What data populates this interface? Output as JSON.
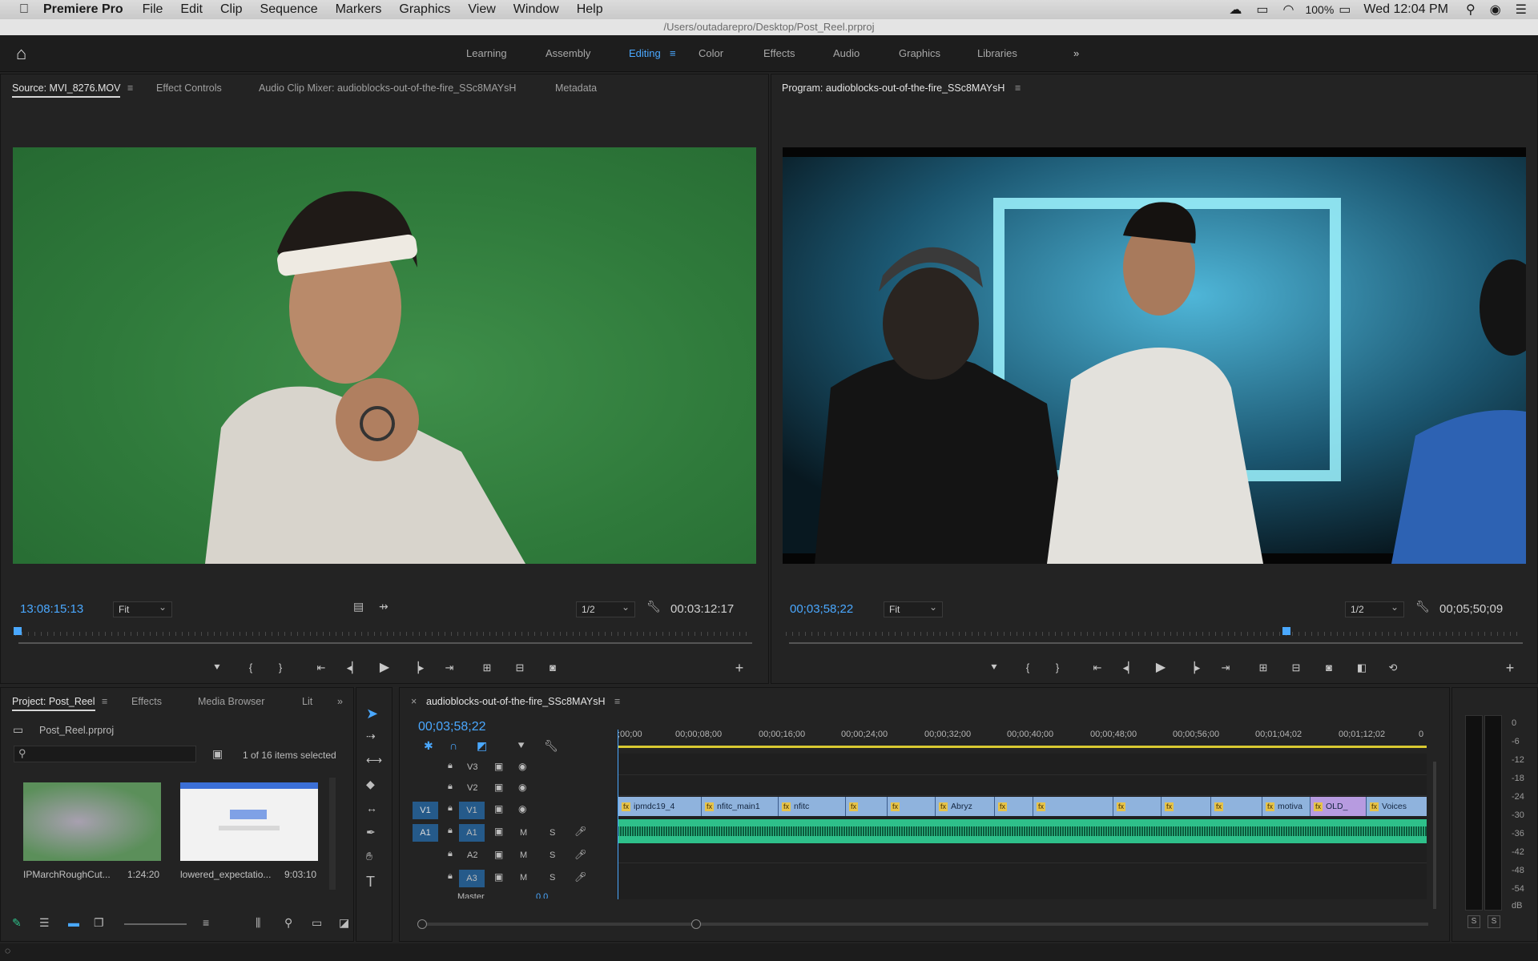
{
  "menubar": {
    "app": "Premiere Pro",
    "items": [
      "File",
      "Edit",
      "Clip",
      "Sequence",
      "Markers",
      "Graphics",
      "View",
      "Window",
      "Help"
    ],
    "battery": "100%",
    "clock": "Wed 12:04 PM"
  },
  "titlebar": "/Users/outadarepro/Desktop/Post_Reel.prproj",
  "workspaces": [
    "Learning",
    "Assembly",
    "Editing",
    "Color",
    "Effects",
    "Audio",
    "Graphics",
    "Libraries"
  ],
  "active_workspace": "Editing",
  "source": {
    "tabs": [
      "Source: MVI_8276.MOV",
      "Effect Controls",
      "Audio Clip Mixer: audioblocks-out-of-the-fire_SSc8MAYsH",
      "Metadata"
    ],
    "timecode": "13:08:15:13",
    "fit": "Fit",
    "resolution": "1/2",
    "duration": "00:03:12:17"
  },
  "program": {
    "tab": "Program: audioblocks-out-of-the-fire_SSc8MAYsH",
    "timecode": "00;03;58;22",
    "fit": "Fit",
    "resolution": "1/2",
    "duration": "00;05;50;09"
  },
  "project": {
    "tabs": [
      "Project: Post_Reel",
      "Effects",
      "Media Browser",
      "Lit"
    ],
    "file": "Post_Reel.prproj",
    "selection": "1 of 16 items selected",
    "items": [
      {
        "name": "IPMarchRoughCut...",
        "duration": "1:24:20"
      },
      {
        "name": "lowered_expectatio...",
        "duration": "9:03:10"
      }
    ]
  },
  "timeline": {
    "tab": "audioblocks-out-of-the-fire_SSc8MAYsH",
    "timecode": "00;03;58;22",
    "ruler": [
      ";00;00",
      "00;00;08;00",
      "00;00;16;00",
      "00;00;24;00",
      "00;00;32;00",
      "00;00;40;00",
      "00;00;48;00",
      "00;00;56;00",
      "00;01;04;02",
      "00;01;12;02",
      "0"
    ],
    "video_tracks": [
      "V3",
      "V2",
      "V1"
    ],
    "audio_tracks": [
      "A1",
      "A2",
      "A3"
    ],
    "master": "Master",
    "master_value": "0.0",
    "clips": [
      "ipmdc19_4",
      "nfitc_main1",
      "nfitc",
      "Abryz",
      "motiva",
      "OLD_",
      "Voices"
    ]
  },
  "meter": {
    "ticks": [
      "0",
      "-6",
      "-12",
      "-18",
      "-24",
      "-30",
      "-36",
      "-42",
      "-48",
      "-54",
      "dB"
    ],
    "solo": [
      "S",
      "S"
    ]
  },
  "colors": {
    "accent": "#4aa8ff",
    "audio": "#2ec08a",
    "clip": "#8fb3dd",
    "purple": "#b79be0"
  }
}
